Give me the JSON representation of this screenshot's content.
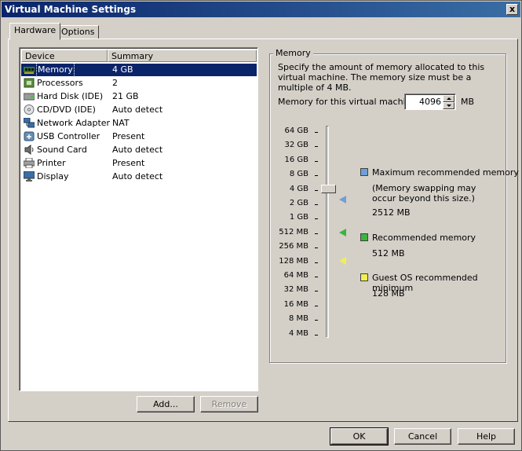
{
  "window": {
    "title": "Virtual Machine Settings",
    "close_glyph": "x"
  },
  "tabs": [
    {
      "label": "Hardware"
    },
    {
      "label": "Options"
    }
  ],
  "device_list": {
    "headers": {
      "device": "Device",
      "summary": "Summary"
    },
    "rows": [
      {
        "name": "Memory",
        "summary": "4 GB",
        "icon": "memory-icon"
      },
      {
        "name": "Processors",
        "summary": "2",
        "icon": "processor-icon"
      },
      {
        "name": "Hard Disk (IDE)",
        "summary": "21 GB",
        "icon": "hard-disk-icon"
      },
      {
        "name": "CD/DVD (IDE)",
        "summary": "Auto detect",
        "icon": "cd-dvd-icon"
      },
      {
        "name": "Network Adapter",
        "summary": "NAT",
        "icon": "network-adapter-icon"
      },
      {
        "name": "USB Controller",
        "summary": "Present",
        "icon": "usb-icon"
      },
      {
        "name": "Sound Card",
        "summary": "Auto detect",
        "icon": "sound-card-icon"
      },
      {
        "name": "Printer",
        "summary": "Present",
        "icon": "printer-icon"
      },
      {
        "name": "Display",
        "summary": "Auto detect",
        "icon": "display-icon"
      }
    ],
    "add_label": "Add...",
    "remove_label": "Remove"
  },
  "memory": {
    "group_title": "Memory",
    "description": "Specify the amount of memory allocated to this virtual machine. The memory size must be a multiple of 4 MB.",
    "field_label": "Memory for this virtual machine:",
    "value": "4096",
    "unit": "MB",
    "scale_labels": [
      "64 GB",
      "32 GB",
      "16 GB",
      "8 GB",
      "4 GB",
      "2 GB",
      "1 GB",
      "512 MB",
      "256 MB",
      "128 MB",
      "64 MB",
      "32 MB",
      "16 MB",
      "8 MB",
      "4 MB"
    ],
    "legend": {
      "max": {
        "title": "Maximum recommended memory",
        "note": "(Memory swapping may occur beyond this size.)",
        "value": "2512 MB",
        "color": "#6f9fd8"
      },
      "recommended": {
        "title": "Recommended memory",
        "value": "512 MB",
        "color": "#3cb43c"
      },
      "guest_min": {
        "title": "Guest OS recommended minimum",
        "value": "128 MB",
        "color": "#f0f050"
      }
    }
  },
  "footer": {
    "ok": "OK",
    "cancel": "Cancel",
    "help": "Help"
  }
}
